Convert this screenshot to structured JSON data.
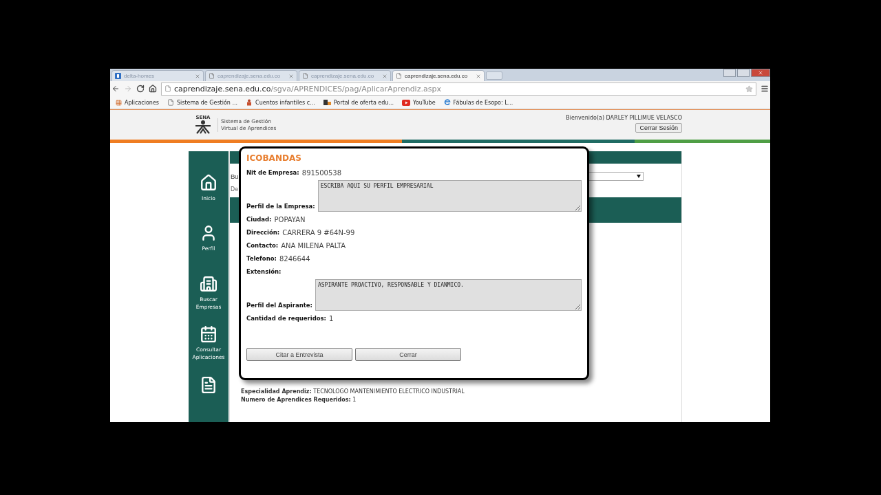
{
  "browser": {
    "tabs": [
      {
        "title": "delta-homes",
        "kind": "brand",
        "selected": false
      },
      {
        "title": "caprendizaje.sena.edu.co",
        "kind": "page",
        "selected": false
      },
      {
        "title": "caprendizaje.sena.edu.co",
        "kind": "page",
        "selected": false
      },
      {
        "title": "caprendizaje.sena.edu.co",
        "kind": "page",
        "selected": true
      }
    ],
    "address": {
      "host": "caprendizaje.sena.edu.co",
      "path": "/sgva/APRENDICES/pag/AplicarAprendiz.aspx"
    },
    "bookmarks": [
      {
        "label": "Aplicaciones",
        "kind": "apps"
      },
      {
        "label": "Sistema de Gestión ...",
        "kind": "page"
      },
      {
        "label": "Cuentos infantiles c...",
        "kind": "figure"
      },
      {
        "label": "Portal de oferta edu...",
        "kind": "portal"
      },
      {
        "label": "YouTube",
        "kind": "video"
      },
      {
        "label": "Fábulas de Esopo: L...",
        "kind": "ie"
      }
    ]
  },
  "header": {
    "logo": "SENA",
    "system_name": [
      "Sistema de Gestión",
      "Virtual de Aprendices"
    ],
    "welcome": "Bienvenido(a) DARLEY PILLIMUE VELASCO",
    "logout": "Cerrar Sesión"
  },
  "sidebar": {
    "items": [
      {
        "label": "Inicio",
        "kind": "home"
      },
      {
        "label": "Perfil",
        "kind": "user"
      },
      {
        "label": "Buscar Empresas",
        "kind": "building"
      },
      {
        "label": "Consultar Aplicaciones",
        "kind": "calendar"
      },
      {
        "kind": "document"
      }
    ]
  },
  "content": {
    "heading_fragment": "Bu",
    "subheading_fragment": "De",
    "details": [
      {
        "label": "Especialidad Aprendiz:",
        "value": "TECNOLOGO MANTENIMIENTO ELECTRICO INDUSTRIAL"
      },
      {
        "label": "Numero de Aprendices Requeridos:",
        "value": "1"
      }
    ]
  },
  "modal": {
    "title": "ICOBANDAS",
    "fields": [
      {
        "kind": "text",
        "label": "Nit de Empresa:",
        "value": "891500538"
      },
      {
        "kind": "textarea",
        "label": "Perfil de la Empresa:",
        "value": "ESCRIBA AQUI SU PERFIL EMPRESARIAL"
      },
      {
        "kind": "text",
        "label": "Ciudad:",
        "value": "POPAYAN"
      },
      {
        "kind": "text",
        "label": "Dirección:",
        "value": "CARRERA 9 #64N-99"
      },
      {
        "kind": "text",
        "label": "Contacto:",
        "value": "ANA MILENA PALTA"
      },
      {
        "kind": "text",
        "label": "Telefono:",
        "value": "8246644"
      },
      {
        "kind": "text",
        "label": "Extensión:"
      },
      {
        "kind": "textarea",
        "label": "Perfil del Aspirante:",
        "value": "ASPIRANTE PROACTIVO, RESPONSABLE Y DIANMICO."
      },
      {
        "kind": "text",
        "label": "Cantidad de requeridos:",
        "value": "1"
      }
    ],
    "buttons": [
      "Citar a Entrevista",
      "Cerrar"
    ]
  }
}
